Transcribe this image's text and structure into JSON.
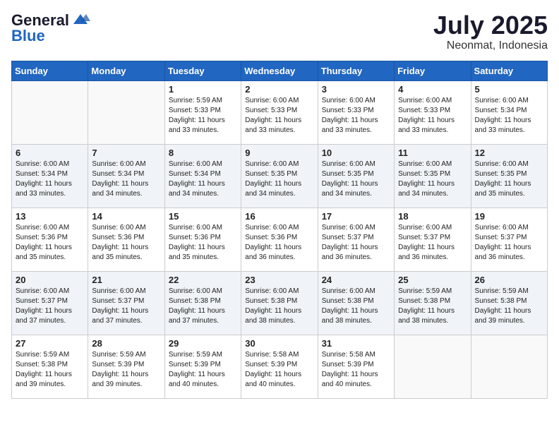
{
  "header": {
    "logo": {
      "general": "General",
      "blue": "Blue"
    },
    "month": "July 2025",
    "location": "Neonmat, Indonesia"
  },
  "weekdays": [
    "Sunday",
    "Monday",
    "Tuesday",
    "Wednesday",
    "Thursday",
    "Friday",
    "Saturday"
  ],
  "weeks": [
    [
      {
        "day": "",
        "sunrise": "",
        "sunset": "",
        "daylight": ""
      },
      {
        "day": "",
        "sunrise": "",
        "sunset": "",
        "daylight": ""
      },
      {
        "day": "1",
        "sunrise": "Sunrise: 5:59 AM",
        "sunset": "Sunset: 5:33 PM",
        "daylight": "Daylight: 11 hours and 33 minutes."
      },
      {
        "day": "2",
        "sunrise": "Sunrise: 6:00 AM",
        "sunset": "Sunset: 5:33 PM",
        "daylight": "Daylight: 11 hours and 33 minutes."
      },
      {
        "day": "3",
        "sunrise": "Sunrise: 6:00 AM",
        "sunset": "Sunset: 5:33 PM",
        "daylight": "Daylight: 11 hours and 33 minutes."
      },
      {
        "day": "4",
        "sunrise": "Sunrise: 6:00 AM",
        "sunset": "Sunset: 5:33 PM",
        "daylight": "Daylight: 11 hours and 33 minutes."
      },
      {
        "day": "5",
        "sunrise": "Sunrise: 6:00 AM",
        "sunset": "Sunset: 5:34 PM",
        "daylight": "Daylight: 11 hours and 33 minutes."
      }
    ],
    [
      {
        "day": "6",
        "sunrise": "Sunrise: 6:00 AM",
        "sunset": "Sunset: 5:34 PM",
        "daylight": "Daylight: 11 hours and 33 minutes."
      },
      {
        "day": "7",
        "sunrise": "Sunrise: 6:00 AM",
        "sunset": "Sunset: 5:34 PM",
        "daylight": "Daylight: 11 hours and 34 minutes."
      },
      {
        "day": "8",
        "sunrise": "Sunrise: 6:00 AM",
        "sunset": "Sunset: 5:34 PM",
        "daylight": "Daylight: 11 hours and 34 minutes."
      },
      {
        "day": "9",
        "sunrise": "Sunrise: 6:00 AM",
        "sunset": "Sunset: 5:35 PM",
        "daylight": "Daylight: 11 hours and 34 minutes."
      },
      {
        "day": "10",
        "sunrise": "Sunrise: 6:00 AM",
        "sunset": "Sunset: 5:35 PM",
        "daylight": "Daylight: 11 hours and 34 minutes."
      },
      {
        "day": "11",
        "sunrise": "Sunrise: 6:00 AM",
        "sunset": "Sunset: 5:35 PM",
        "daylight": "Daylight: 11 hours and 34 minutes."
      },
      {
        "day": "12",
        "sunrise": "Sunrise: 6:00 AM",
        "sunset": "Sunset: 5:35 PM",
        "daylight": "Daylight: 11 hours and 35 minutes."
      }
    ],
    [
      {
        "day": "13",
        "sunrise": "Sunrise: 6:00 AM",
        "sunset": "Sunset: 5:36 PM",
        "daylight": "Daylight: 11 hours and 35 minutes."
      },
      {
        "day": "14",
        "sunrise": "Sunrise: 6:00 AM",
        "sunset": "Sunset: 5:36 PM",
        "daylight": "Daylight: 11 hours and 35 minutes."
      },
      {
        "day": "15",
        "sunrise": "Sunrise: 6:00 AM",
        "sunset": "Sunset: 5:36 PM",
        "daylight": "Daylight: 11 hours and 35 minutes."
      },
      {
        "day": "16",
        "sunrise": "Sunrise: 6:00 AM",
        "sunset": "Sunset: 5:36 PM",
        "daylight": "Daylight: 11 hours and 36 minutes."
      },
      {
        "day": "17",
        "sunrise": "Sunrise: 6:00 AM",
        "sunset": "Sunset: 5:37 PM",
        "daylight": "Daylight: 11 hours and 36 minutes."
      },
      {
        "day": "18",
        "sunrise": "Sunrise: 6:00 AM",
        "sunset": "Sunset: 5:37 PM",
        "daylight": "Daylight: 11 hours and 36 minutes."
      },
      {
        "day": "19",
        "sunrise": "Sunrise: 6:00 AM",
        "sunset": "Sunset: 5:37 PM",
        "daylight": "Daylight: 11 hours and 36 minutes."
      }
    ],
    [
      {
        "day": "20",
        "sunrise": "Sunrise: 6:00 AM",
        "sunset": "Sunset: 5:37 PM",
        "daylight": "Daylight: 11 hours and 37 minutes."
      },
      {
        "day": "21",
        "sunrise": "Sunrise: 6:00 AM",
        "sunset": "Sunset: 5:37 PM",
        "daylight": "Daylight: 11 hours and 37 minutes."
      },
      {
        "day": "22",
        "sunrise": "Sunrise: 6:00 AM",
        "sunset": "Sunset: 5:38 PM",
        "daylight": "Daylight: 11 hours and 37 minutes."
      },
      {
        "day": "23",
        "sunrise": "Sunrise: 6:00 AM",
        "sunset": "Sunset: 5:38 PM",
        "daylight": "Daylight: 11 hours and 38 minutes."
      },
      {
        "day": "24",
        "sunrise": "Sunrise: 6:00 AM",
        "sunset": "Sunset: 5:38 PM",
        "daylight": "Daylight: 11 hours and 38 minutes."
      },
      {
        "day": "25",
        "sunrise": "Sunrise: 5:59 AM",
        "sunset": "Sunset: 5:38 PM",
        "daylight": "Daylight: 11 hours and 38 minutes."
      },
      {
        "day": "26",
        "sunrise": "Sunrise: 5:59 AM",
        "sunset": "Sunset: 5:38 PM",
        "daylight": "Daylight: 11 hours and 39 minutes."
      }
    ],
    [
      {
        "day": "27",
        "sunrise": "Sunrise: 5:59 AM",
        "sunset": "Sunset: 5:38 PM",
        "daylight": "Daylight: 11 hours and 39 minutes."
      },
      {
        "day": "28",
        "sunrise": "Sunrise: 5:59 AM",
        "sunset": "Sunset: 5:39 PM",
        "daylight": "Daylight: 11 hours and 39 minutes."
      },
      {
        "day": "29",
        "sunrise": "Sunrise: 5:59 AM",
        "sunset": "Sunset: 5:39 PM",
        "daylight": "Daylight: 11 hours and 40 minutes."
      },
      {
        "day": "30",
        "sunrise": "Sunrise: 5:58 AM",
        "sunset": "Sunset: 5:39 PM",
        "daylight": "Daylight: 11 hours and 40 minutes."
      },
      {
        "day": "31",
        "sunrise": "Sunrise: 5:58 AM",
        "sunset": "Sunset: 5:39 PM",
        "daylight": "Daylight: 11 hours and 40 minutes."
      },
      {
        "day": "",
        "sunrise": "",
        "sunset": "",
        "daylight": ""
      },
      {
        "day": "",
        "sunrise": "",
        "sunset": "",
        "daylight": ""
      }
    ]
  ]
}
